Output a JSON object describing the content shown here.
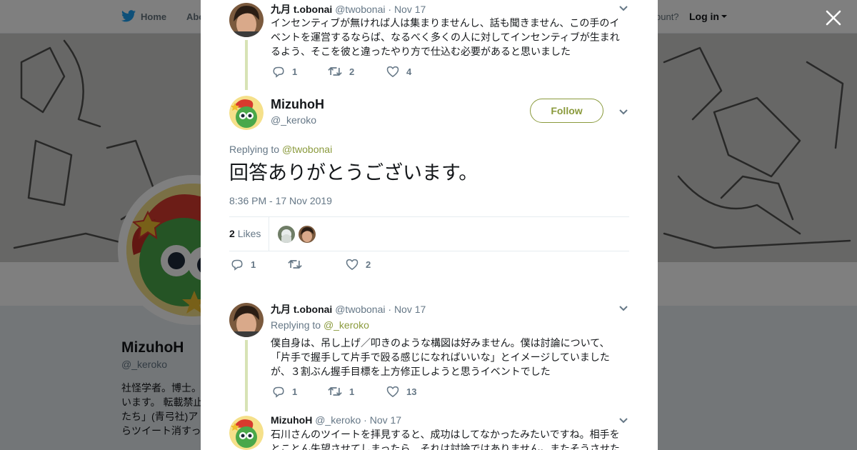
{
  "nav": {
    "home": "Home",
    "about": "Abo",
    "account": "ccount?",
    "login": "Log in"
  },
  "profile": {
    "name": "MizuhoH",
    "handle": "@_keroko",
    "bio_lines": [
      "社怪学者。博士。",
      "います。 転載禁止",
      "たち」(青弓社)ア",
      "らツイート消すっ"
    ]
  },
  "tweets": [
    {
      "name": "九月 t.obonai",
      "handle": "@twobonai",
      "date": "Nov 17",
      "text": "インセンティブが無ければ人は集まりませんし、話も聞きません、この手のイベントを運営するならば、なるべく多くの人に対してインセンティブが生まれるよう、そこを彼と違ったやり方で仕込む必要があると思いました",
      "replies": "1",
      "retweets": "2",
      "likes": "4"
    },
    {
      "name": "九月 t.obonai",
      "handle": "@twobonai",
      "date": "Nov 17",
      "replying_label": "Replying to",
      "replying_to": "@_keroko",
      "text": "僕自身は、吊し上げ／叩きのような構図は好みません。僕は討論について、「片手で握手して片手で殴る感じになればいいな」とイメージしていましたが、３割ぶん握手目標を上方修正しようと思うイベントでした",
      "replies": "1",
      "retweets": "1",
      "likes": "13"
    },
    {
      "name": "MizuhoH",
      "handle": "@_keroko",
      "date": "Nov 17",
      "text": "石川さんのツイートを拝見すると、成功はしてなかったみたいですね。相手をとことん失望させてしまったら、それは討論ではありません。またそうさせた"
    }
  ],
  "main_tweet": {
    "name": "MizuhoH",
    "handle": "@_keroko",
    "follow_label": "Follow",
    "replying_label": "Replying to",
    "replying_to": "@twobonai",
    "text": "回答ありがとうございます。",
    "timestamp": "8:36 PM - 17 Nov 2019",
    "likes_count": "2",
    "likes_label": "Likes",
    "replies": "1",
    "retweets": "",
    "likes": "2"
  },
  "colors": {
    "accent": "#8a9a3c",
    "thread_line": "#d7e3b5",
    "muted": "#657786"
  },
  "icons": [
    "twitter-bird-icon",
    "close-icon",
    "reply-icon",
    "retweet-icon",
    "heart-icon",
    "chevron-down-icon"
  ]
}
